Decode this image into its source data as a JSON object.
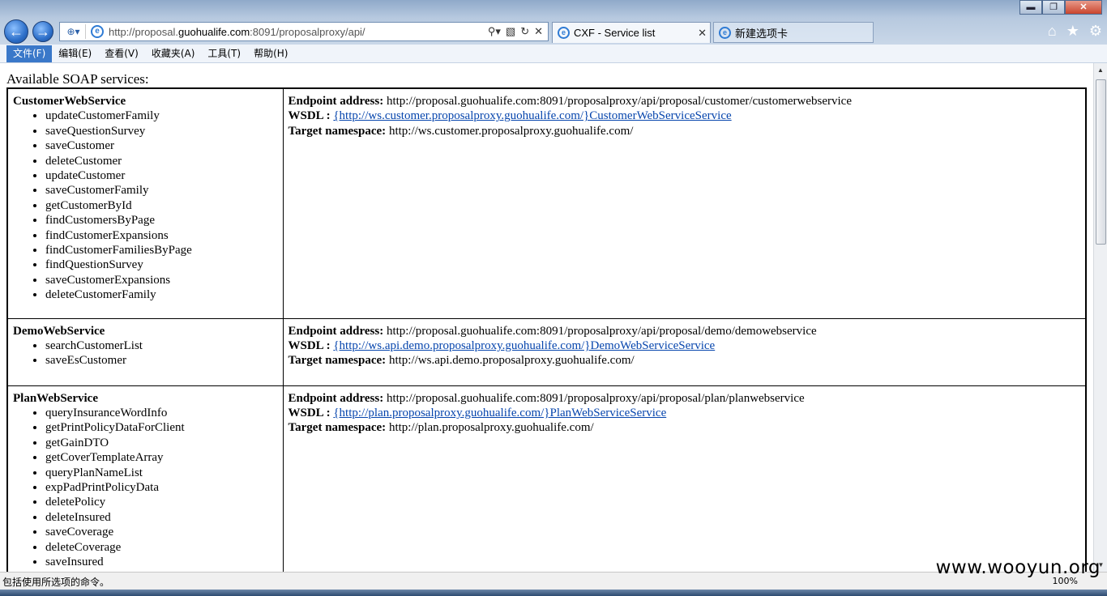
{
  "browser": {
    "url_prefix": "http://proposal.",
    "url_host": "guohualife.com",
    "url_suffix": ":8091/proposalproxy/api/",
    "tabs": [
      {
        "label": "CXF - Service list"
      },
      {
        "label": "新建选项卡"
      }
    ],
    "menu": [
      "文件(F)",
      "编辑(E)",
      "查看(V)",
      "收藏夹(A)",
      "工具(T)",
      "帮助(H)"
    ]
  },
  "page": {
    "title": "Available SOAP services:",
    "labels": {
      "endpoint": "Endpoint address:",
      "wsdl": "WSDL :",
      "namespace": "Target namespace:"
    },
    "services": [
      {
        "name": "CustomerWebService",
        "operations": [
          "updateCustomerFamily",
          "saveQuestionSurvey",
          "saveCustomer",
          "deleteCustomer",
          "updateCustomer",
          "saveCustomerFamily",
          "getCustomerById",
          "findCustomersByPage",
          "findCustomerExpansions",
          "findCustomerFamiliesByPage",
          "findQuestionSurvey",
          "saveCustomerExpansions",
          "deleteCustomerFamily"
        ],
        "endpoint": "http://proposal.guohualife.com:8091/proposalproxy/api/proposal/customer/customerwebservice",
        "wsdl": "{http://ws.customer.proposalproxy.guohualife.com/}CustomerWebServiceService",
        "namespace": "http://ws.customer.proposalproxy.guohualife.com/"
      },
      {
        "name": "DemoWebService",
        "operations": [
          "searchCustomerList",
          "saveEsCustomer"
        ],
        "endpoint": "http://proposal.guohualife.com:8091/proposalproxy/api/proposal/demo/demowebservice",
        "wsdl": "{http://ws.api.demo.proposalproxy.guohualife.com/}DemoWebServiceService",
        "namespace": "http://ws.api.demo.proposalproxy.guohualife.com/"
      },
      {
        "name": "PlanWebService",
        "operations": [
          "queryInsuranceWordInfo",
          "getPrintPolicyDataForClient",
          "getGainDTO",
          "getCoverTemplateArray",
          "queryPlanNameList",
          "expPadPrintPolicyData",
          "deletePolicy",
          "deleteInsured",
          "saveCoverage",
          "deleteCoverage",
          "saveInsured"
        ],
        "endpoint": "http://proposal.guohualife.com:8091/proposalproxy/api/proposal/plan/planwebservice",
        "wsdl": "{http://plan.proposalproxy.guohualife.com/}PlanWebServiceService",
        "namespace": "http://plan.proposalproxy.guohualife.com/"
      }
    ]
  },
  "status": {
    "text": "包括使用所选项的命令。",
    "zoom": "100%"
  },
  "watermark": "www.wooyun.org"
}
